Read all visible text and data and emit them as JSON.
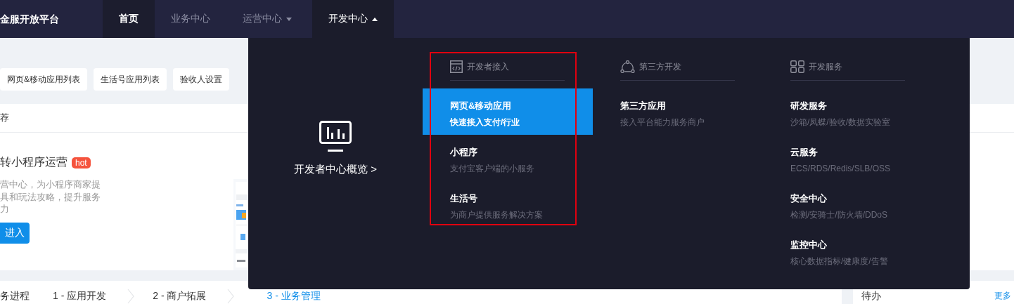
{
  "brand": {
    "title": "金服开放平台"
  },
  "nav": [
    {
      "kind": "link",
      "label": "首页",
      "selected": true
    },
    {
      "kind": "link",
      "label": "业务中心",
      "selected": false
    },
    {
      "kind": "menu",
      "label": "运营中心",
      "selected": false,
      "expanded": false
    },
    {
      "kind": "menu",
      "label": "开发中心",
      "selected": false,
      "expanded": true
    }
  ],
  "quick_links": [
    "网页&移动应用列表",
    "生活号应用列表",
    "验收人设置"
  ],
  "card": {
    "header": "荐",
    "title": "转小程序运营",
    "badge": "hot",
    "description": [
      "营中心，为小程序商家提",
      "具和玩法攻略，提升服务",
      "力"
    ],
    "button": "进入",
    "media": {
      "kind": "picture"
    }
  },
  "progress": {
    "label": "务进程",
    "steps": [
      {
        "label": "1 - 应用开发",
        "selected": false
      },
      {
        "label": "2 - 商户拓展",
        "selected": false
      },
      {
        "label": "3 - 业务管理",
        "selected": true
      }
    ]
  },
  "todo": {
    "title": "待办",
    "more": "更多"
  },
  "dropdown": {
    "overview": "开发者中心概览 >",
    "columns": [
      {
        "kind": "code",
        "title": "开发者接入",
        "highlighted": true,
        "items": [
          {
            "title": "网页&移动应用",
            "subtitle": "快速接入支付/行业",
            "selected": true
          },
          {
            "title": "小程序",
            "subtitle": "支付宝客户端的小服务",
            "selected": false
          },
          {
            "title": "生活号",
            "subtitle": "为商户提供服务解决方案",
            "selected": false
          }
        ]
      },
      {
        "kind": "nodes",
        "title": "第三方开发",
        "highlighted": false,
        "items": [
          {
            "title": "第三方应用",
            "subtitle": "接入平台能力服务商户",
            "selected": false
          }
        ]
      },
      {
        "kind": "grid",
        "title": "开发服务",
        "highlighted": false,
        "items": [
          {
            "title": "研发服务",
            "subtitle": "沙箱/凤蝶/验收/数据实验室",
            "selected": false
          },
          {
            "title": "云服务",
            "subtitle": "ECS/RDS/Redis/SLB/OSS",
            "selected": false
          },
          {
            "title": "安全中心",
            "subtitle": "检测/安骑士/防火墙/DDoS",
            "selected": false
          },
          {
            "title": "监控中心",
            "subtitle": "核心数据指标/健康度/告警",
            "selected": false
          }
        ]
      }
    ]
  }
}
